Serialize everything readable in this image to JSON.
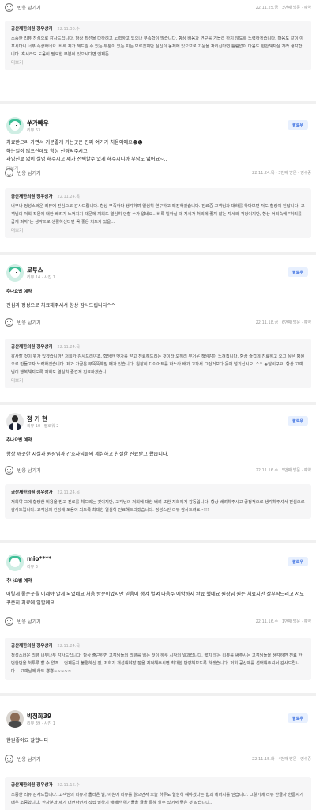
{
  "react_label": "반응 남기기",
  "follow_label": "팔로우",
  "more_label": "더보기",
  "reply_name": "공산재한의원 정우상가",
  "review0": {
    "meta": "22.11.25.금 · 3번째 방문 · 예약",
    "reply_date": "22.11.30.수",
    "reply_text": "소중한 리뷰 진심으로 감사드립니다. 항상 최선을 다하려고 노력하고 있으나 부족함이 많습니다. 항상 배움과 연구를 거듭리 하지 않도록 노력하겠습니다. 마음도 같이 아프시다니 너무 속상하네요. 비록 제가 헤드릴 수 있는 부분이 있는 지는 모르겠지만 심신이 동체에 있으므로 기운을 차리신다면 틀림없이 마음도 편안해지실 거라 생각합니다. 혹시라도 도움이 필요한 부분이 있으시다면 언제든..."
  },
  "review1": {
    "name": "쑤가빼우",
    "sub": "리뷰 63",
    "body": "치료받으러 가면서 기분좋게 가는곳은 진짜 여기가 처음이예요☻☻\n하는일이 많으신데도 항상 신경써주시고\n과잉진료 없이 설명 해주시고 제가 선택할수 있게 해주시니까 부담도 없어요~..",
    "meta": "22.11.24.목 · 3번째 방문 · 영수증",
    "reply_date": "22.11.24.목",
    "reply_text": "너무나 정성스러운 리뷰에 진심으로 감사드립니다. 항상 부족하다 생각하며 열심히 연구하고 매진하겠습니다. 진료중 고객님과 대화를 하다보면 저도 힐링이 된답니다. 고객님의 저희 직원에 대한 배려가 느껴지기 때문에 저희도 열심히 안할 수가 없네요.. 비록 일하실 때 지세가 허리에 좋지 않는 자세라 걱정이지만, 항상 어리숙에 \"허리를 굽게 펴자\"는 생각으로 생활하신다면 꼭 좋은 치도가 있을..."
  },
  "review2": {
    "name": "로투스",
    "sub": "리뷰 14 · 사진 1",
    "visit": "추나요법 예약",
    "body": "진심과 정성으로 치료해주셔서 항상 감사드립니다^^",
    "meta": "22.11.18.금 · 6번째 방문 · 예약",
    "reply_date": "22.11.24.목",
    "reply_text": "감사할 것이 뭐가 있겠습니까? 저희가 감사드려야죠. 합당한 댓가를 받고 진료해드리는 것이라 오히려 무거운 책임감이 느껴집니다. 항상 즐겁게 진료하고 오고 싶은 병원으로 만들고자 노력하겠습니다. 제가 가끔은 무뚝뚝해질 때가 있습니다. 원장이 다이어트를 하느라 배가 고파서 그런거보다 웃어 넘기십시오..^^ 농담이구요. 항상 고객님이 행복해지도록 저희도 열심히 즐겁게 진료하겠습니..."
  },
  "review3": {
    "name": "정 기 현",
    "sub": "리뷰 10 · 팔로워 2",
    "visit": "추나요법 예약",
    "body": "항상 깨끗한 시설과 원장님과 간호사님들의 세심하고 친절한 진료받고 왔습니다.",
    "meta": "22.11.16.수 · 5번째 방문 · 예약",
    "reply_date": "22.11.24.목",
    "reply_text": "저희야 그에 합당한 비용을 받고 진료를 해드리는 것이지만, 고객님의 저희에 대한 배려 또한 저희에게 감동입니다. 항상 배려해주시고 긍정적으로 생각해주셔서 진심으로 감사드립니다. 고객님의 건강에 도움이 되도록 최대한 열심히 진료해드리겠습니다. 정성스런 리뷰 감사드려요~!!!"
  },
  "review4": {
    "name": "mio****",
    "sub": "리뷰 3",
    "visit": "추나요법 예약",
    "body": "어렇게 좋은곳을 이제야 알게 되었네요 처음 방문이었지만 믿음이 생겨 벌써 다음주 예약까지 완료 했네요 원장님 뭔든 치료지만 잘부탁드리고 저도 꾸준히 치료에 임할께요",
    "meta": "22.11.16.수 · 1번째 방문 · 예약",
    "reply_date": "22.11.24.목",
    "reply_text": "정성스러운 리뷰 너무나무 감사드립니다. 항상 출근하면 고객님들의 리뷰를 읽는 것이 하루 시작의 일과랍니다. 짧지 않은 리뷰를 써주시는 고객님들을 생각하면 진료 한번한번을 허투루 할 수 없죠... 언제든지 불편하신 점, 저희가 개선해야할 점을 지적해주시면 최대한 반영해보도록 하겠습니다. 저희 공산재를 선택해주셔서 감사드립니다... 고객님께 하트 뿅뿅~~~~~"
  },
  "review5": {
    "name": "박정화39",
    "sub": "리뷰 39 · 사진 1",
    "body": "한원좋아요 잘합니다",
    "meta": "22.11.15.화 · 4번째 방문 · 영수증",
    "reply_date": "22.11.16.수",
    "reply_text": "소중한 리뷰 감사드립니다. 고객님의 리뷰가 올라온 날, 아침에 리뷰를 읽으면서 오늘 하루도 열심히 해야겠다는 힘과 에너지를 얻습니다. 그렇기에 리뷰 한글자 한글자가 매우 소중합니다. 한자분과 제가 대면하면서 직접 말하기 애매한 얘기들을 글을 통해 할수 있어서 좋은 것 같습니다..."
  }
}
